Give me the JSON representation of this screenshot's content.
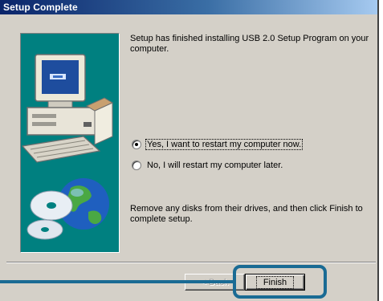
{
  "window": {
    "title": "Setup Complete"
  },
  "message": {
    "top": "Setup has finished installing USB 2.0 Setup Program on your\ncomputer.",
    "bottom": "Remove any disks from their drives, and then click Finish to\ncomplete setup."
  },
  "options": [
    {
      "label": "Yes, I want to restart my computer now.",
      "checked": true
    },
    {
      "label": "No, I will restart my computer later.",
      "checked": false
    }
  ],
  "buttons": {
    "back": "< Back",
    "finish": "Finish"
  },
  "colors": {
    "title_bar": "#0a246a",
    "panel_bg": "#008080",
    "callout": "#1a6b94",
    "dialog_bg": "#d4d0c8"
  },
  "icons": {
    "illustration": "computer-with-cds-and-globe"
  }
}
